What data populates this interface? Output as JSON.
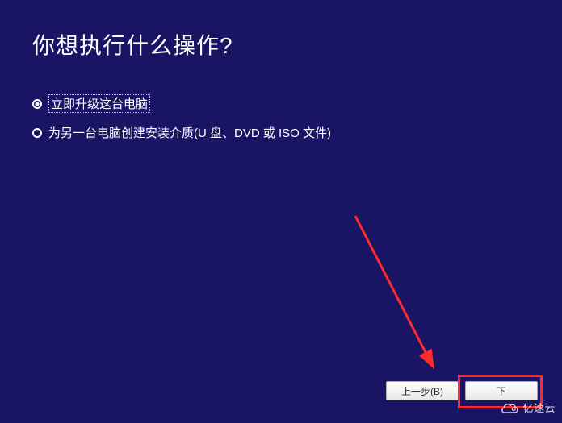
{
  "title": "你想执行什么操作?",
  "options": [
    {
      "label": "立即升级这台电脑",
      "selected": true
    },
    {
      "label": "为另一台电脑创建安装介质(U 盘、DVD 或 ISO 文件)",
      "selected": false
    }
  ],
  "buttons": {
    "back": "上一步(B)",
    "next": "下"
  },
  "watermark": {
    "text": "亿速云"
  },
  "annotations": {
    "highlight_target": "next-button",
    "arrow_color": "#ff2a2a"
  }
}
